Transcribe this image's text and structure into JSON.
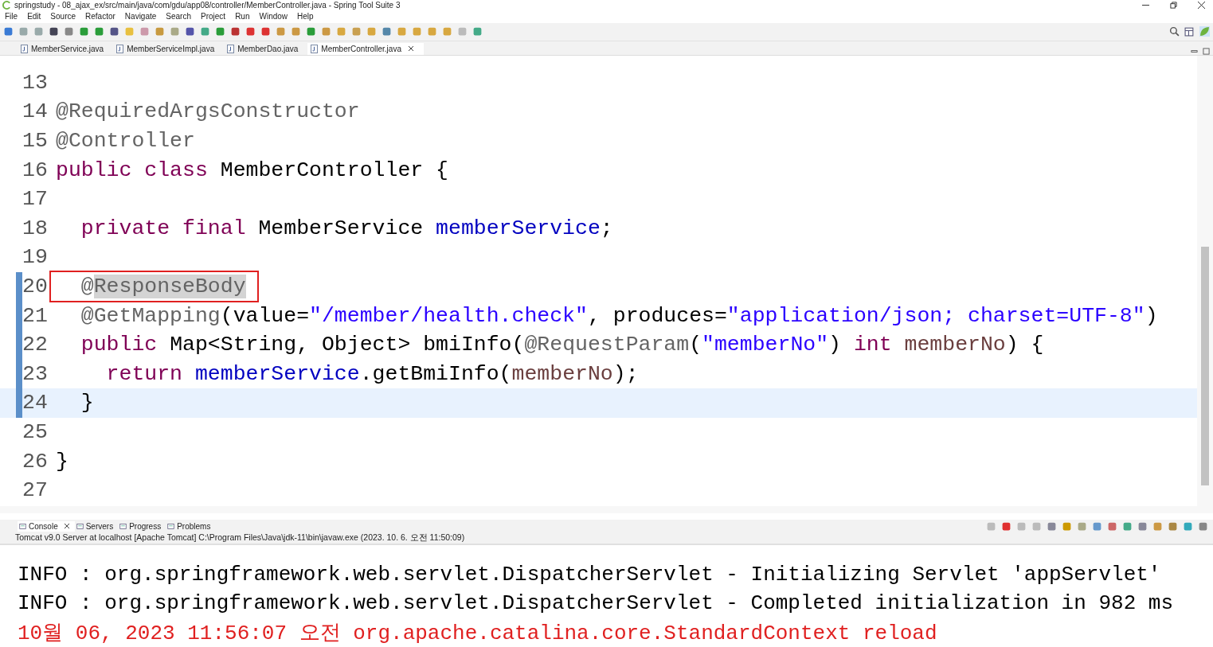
{
  "window": {
    "title": "springstudy - 08_ajax_ex/src/main/java/com/gdu/app08/controller/MemberController.java - Spring Tool Suite 3"
  },
  "menu": [
    "File",
    "Edit",
    "Source",
    "Refactor",
    "Navigate",
    "Search",
    "Project",
    "Run",
    "Window",
    "Help"
  ],
  "editor_tabs": [
    {
      "label": "MemberService.java",
      "selected": false
    },
    {
      "label": "MemberServiceImpl.java",
      "selected": false
    },
    {
      "label": "MemberDao.java",
      "selected": false
    },
    {
      "label": "MemberController.java",
      "selected": true
    }
  ],
  "code_lines": [
    {
      "number": "13",
      "boxed": false,
      "current": false,
      "changed": false
    },
    {
      "number": "14",
      "boxed": false,
      "current": false,
      "changed": false,
      "tokens": [
        {
          "t": "@RequiredArgsConstructor",
          "kind": "ann"
        }
      ]
    },
    {
      "number": "15",
      "boxed": false,
      "current": false,
      "changed": false,
      "tokens": [
        {
          "t": "@Controller",
          "kind": "ann"
        }
      ]
    },
    {
      "number": "16",
      "boxed": false,
      "current": false,
      "changed": false,
      "tokens": [
        {
          "t": "public class",
          "kind": "kw"
        },
        {
          "t": " MemberController {",
          "kind": "plain"
        }
      ]
    },
    {
      "number": "17",
      "boxed": false,
      "current": false,
      "changed": false
    },
    {
      "number": "18",
      "boxed": false,
      "current": false,
      "changed": false,
      "tokens": [
        {
          "t": "  private final",
          "kind": "kw"
        },
        {
          "t": " MemberService ",
          "kind": "plain"
        },
        {
          "t": "memberService",
          "kind": "field"
        },
        {
          "t": ";",
          "kind": "plain"
        }
      ]
    },
    {
      "number": "19",
      "boxed": false,
      "current": false,
      "changed": false
    },
    {
      "number": "20",
      "boxed": true,
      "current": false,
      "changed": true,
      "tokens": [
        {
          "t": "  @",
          "kind": "ann"
        },
        {
          "t": "ResponseBody",
          "kind": "occurrence"
        }
      ]
    },
    {
      "number": "21",
      "boxed": false,
      "current": false,
      "changed": true,
      "tokens": [
        {
          "t": "  @GetMapping",
          "kind": "ann"
        },
        {
          "t": "(value=",
          "kind": "plain"
        },
        {
          "t": "\"/member/health.check\"",
          "kind": "str"
        },
        {
          "t": ", produces=",
          "kind": "plain"
        },
        {
          "t": "\"application/json; charset=UTF-8\"",
          "kind": "str"
        },
        {
          "t": ")",
          "kind": "plain"
        }
      ]
    },
    {
      "number": "22",
      "boxed": false,
      "current": false,
      "changed": true,
      "tokens": [
        {
          "t": "  public",
          "kind": "kw"
        },
        {
          "t": " Map<String, Object> bmiInfo(",
          "kind": "plain"
        },
        {
          "t": "@RequestParam",
          "kind": "ann"
        },
        {
          "t": "(",
          "kind": "plain"
        },
        {
          "t": "\"memberNo\"",
          "kind": "str"
        },
        {
          "t": ") ",
          "kind": "plain"
        },
        {
          "t": "int",
          "kind": "kw"
        },
        {
          "t": " memberNo",
          "kind": "param"
        },
        {
          "t": ") {",
          "kind": "plain"
        }
      ]
    },
    {
      "number": "23",
      "boxed": false,
      "current": false,
      "changed": true,
      "tokens": [
        {
          "t": "    return",
          "kind": "kw"
        },
        {
          "t": " memberService",
          "kind": "field"
        },
        {
          "t": ".getBmiInfo(",
          "kind": "plain"
        },
        {
          "t": "memberNo",
          "kind": "param"
        },
        {
          "t": ");",
          "kind": "plain"
        }
      ]
    },
    {
      "number": "24",
      "boxed": false,
      "current": true,
      "changed": true,
      "tokens": [
        {
          "t": "  }",
          "kind": "plain"
        }
      ]
    },
    {
      "number": "25",
      "boxed": false,
      "current": false,
      "changed": false
    },
    {
      "number": "26",
      "boxed": false,
      "current": false,
      "changed": false,
      "tokens": [
        {
          "t": "}",
          "kind": "plain"
        }
      ]
    },
    {
      "number": "27",
      "boxed": false,
      "current": false,
      "changed": false
    }
  ],
  "console_tabs": [
    {
      "label": "Console",
      "selected": true
    },
    {
      "label": "Servers",
      "selected": false
    },
    {
      "label": "Progress",
      "selected": false
    },
    {
      "label": "Problems",
      "selected": false
    }
  ],
  "console_description": "Tomcat v9.0 Server at localhost [Apache Tomcat] C:\\Program Files\\Java\\jdk-11\\bin\\javaw.exe  (2023. 10. 6. 오전 11:50:09)",
  "console_lines": [
    {
      "text": "INFO : org.springframework.web.servlet.DispatcherServlet - Initializing Servlet 'appServlet'",
      "kind": "out"
    },
    {
      "text": "INFO : org.springframework.web.servlet.DispatcherServlet - Completed initialization in 982 ms",
      "kind": "out"
    },
    {
      "text": "10월 06, 2023 11:56:07 오전 org.apache.catalina.core.StandardContext reload",
      "kind": "err"
    }
  ]
}
